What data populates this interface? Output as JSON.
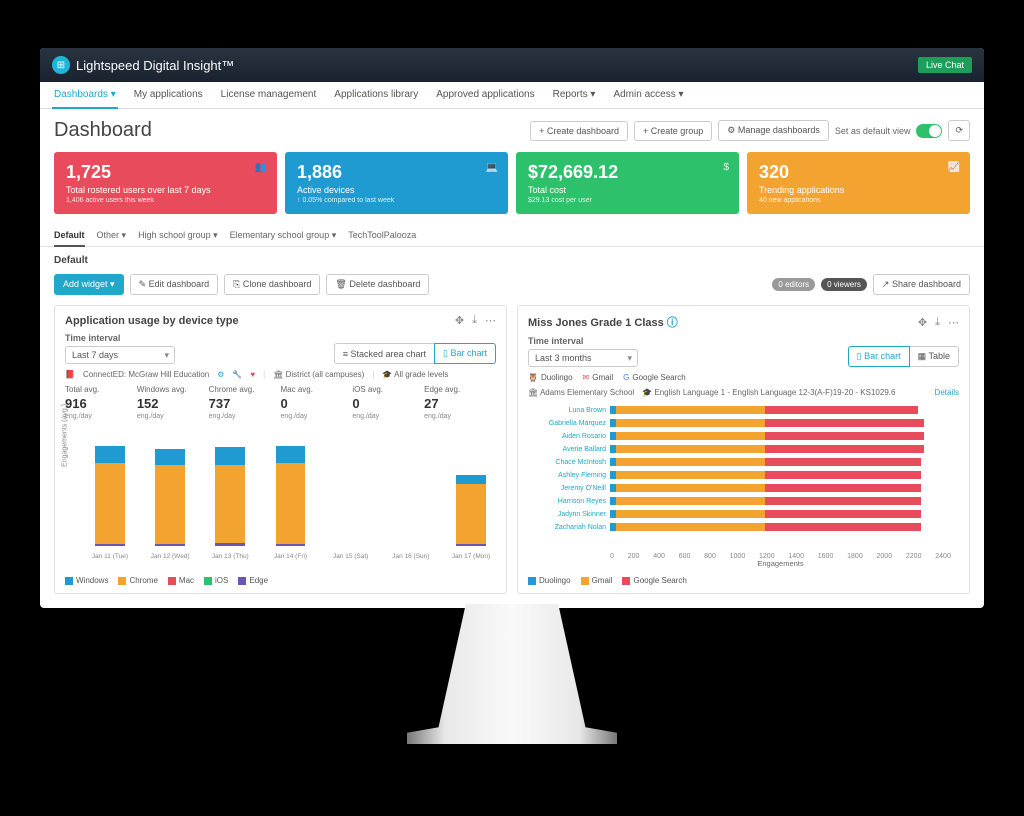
{
  "brand": "Lightspeed Digital Insight™",
  "livechat": "Live Chat",
  "nav": [
    "Dashboards",
    "My applications",
    "License management",
    "Applications library",
    "Approved applications",
    "Reports",
    "Admin access"
  ],
  "page_title": "Dashboard",
  "head_buttons": {
    "create_dash": "+ Create dashboard",
    "create_group": "+ Create group",
    "manage": "⚙ Manage dashboards",
    "default_view": "Set as default view"
  },
  "kpis": [
    {
      "value": "1,725",
      "label": "Total rostered users over last 7 days",
      "sub": "1,406 active users this week",
      "icon": "👥"
    },
    {
      "value": "1,886",
      "label": "Active devices",
      "sub": "↑ 0.05% compared to last week",
      "icon": "💻"
    },
    {
      "value": "$72,669.12",
      "label": "Total cost",
      "sub": "$29.13 cost per user",
      "icon": "$"
    },
    {
      "value": "320",
      "label": "Trending applications",
      "sub": "40 new applications",
      "icon": "📈"
    }
  ],
  "group_tabs": [
    "Default",
    "Other",
    "High school group",
    "Elementary school group",
    "TechToolPalooza"
  ],
  "section_title": "Default",
  "toolbar": {
    "add": "Add widget",
    "edit": "✎ Edit dashboard",
    "clone": "⎘ Clone dashboard",
    "delete": "🗑 Delete dashboard",
    "editors": "0 editors",
    "viewers": "0 viewers",
    "share": "↗ Share dashboard"
  },
  "widget1": {
    "title": "Application usage by device type",
    "interval_label": "Time interval",
    "interval": "Last 7 days",
    "view_stacked": "≡ Stacked area chart",
    "view_bar": "▯ Bar chart",
    "meta": {
      "app": "ConnectED: McGraw Hill Education",
      "district": "🏛 District (all campuses)",
      "grades": "🎓 All grade levels"
    },
    "stats": [
      {
        "label": "Total avg.",
        "value": "916",
        "unit": "eng./day"
      },
      {
        "label": "Windows avg.",
        "value": "152",
        "unit": "eng./day"
      },
      {
        "label": "Chrome avg.",
        "value": "737",
        "unit": "eng./day"
      },
      {
        "label": "Mac avg.",
        "value": "0",
        "unit": "eng./day"
      },
      {
        "label": "iOS avg.",
        "value": "0",
        "unit": "eng./day"
      },
      {
        "label": "Edge avg.",
        "value": "27",
        "unit": "eng./day"
      }
    ],
    "ylabel": "Engagements (avg.)",
    "legend": [
      "Windows",
      "Chrome",
      "Mac",
      "iOS",
      "Edge"
    ]
  },
  "widget2": {
    "title": "Miss Jones Grade 1 Class",
    "interval_label": "Time interval",
    "interval": "Last 3 months",
    "view_bar": "▯ Bar chart",
    "view_table": "▦ Table",
    "apps": [
      "Duolingo",
      "Gmail",
      "Google Search"
    ],
    "school": "🏛 Adams Elementary School",
    "class": "🎓 English Language 1 - English Language 12-3(A-F)19-20 - KS1029.6",
    "details": "Details",
    "xlabel": "Engagements",
    "legend": [
      "Duolingo",
      "Gmail",
      "Google Search"
    ]
  },
  "chart_data": [
    {
      "type": "bar",
      "title": "Application usage by device type",
      "ylabel": "Engagements (avg.)",
      "ylim": [
        0,
        1500
      ],
      "categories": [
        "Jan 11 (Tue)",
        "Jan 12 (Wed)",
        "Jan 13 (Thu)",
        "Jan 14 (Fri)",
        "Jan 15 (Sat)",
        "Jan 16 (Sun)",
        "Jan 17 (Mon)"
      ],
      "series": [
        {
          "name": "Windows",
          "values": [
            220,
            210,
            230,
            220,
            0,
            0,
            120
          ]
        },
        {
          "name": "Chrome",
          "values": [
            1040,
            1020,
            1010,
            1050,
            0,
            0,
            780
          ]
        },
        {
          "name": "Mac",
          "values": [
            0,
            0,
            0,
            0,
            0,
            0,
            0
          ]
        },
        {
          "name": "iOS",
          "values": [
            0,
            0,
            0,
            0,
            0,
            0,
            0
          ]
        },
        {
          "name": "Edge",
          "values": [
            30,
            30,
            35,
            30,
            0,
            0,
            25
          ]
        }
      ]
    },
    {
      "type": "bar",
      "orientation": "horizontal",
      "title": "Miss Jones Grade 1 Class",
      "xlabel": "Engagements",
      "xlim": [
        0,
        2400
      ],
      "categories": [
        "Luna Brown",
        "Gabriella Marquez",
        "Aiden Rosario",
        "Averie Ballard",
        "Chace McIntosh",
        "Ashley Fleming",
        "Jeremy O'Neill",
        "Harrison Reyes",
        "Jadynn Skinner",
        "Zachariah Nolan"
      ],
      "series": [
        {
          "name": "Duolingo",
          "values": [
            40,
            40,
            40,
            40,
            40,
            40,
            40,
            40,
            40,
            40
          ]
        },
        {
          "name": "Gmail",
          "values": [
            1050,
            1050,
            1050,
            1050,
            1050,
            1050,
            1050,
            1050,
            1050,
            1050
          ]
        },
        {
          "name": "Google Search",
          "values": [
            1080,
            1120,
            1120,
            1120,
            1100,
            1100,
            1100,
            1100,
            1100,
            1100
          ]
        }
      ],
      "xticks": [
        0,
        200,
        400,
        600,
        800,
        1000,
        1200,
        1400,
        1600,
        1800,
        2000,
        2200,
        2400
      ]
    }
  ],
  "colors": {
    "windows": "#1f9bd1",
    "chrome": "#f2a330",
    "mac": "#e84c5c",
    "ios": "#2ec16b",
    "edge": "#6a54b5",
    "duolingo": "#1f9bd1",
    "gmail": "#f2a330",
    "google": "#e84c5c"
  }
}
